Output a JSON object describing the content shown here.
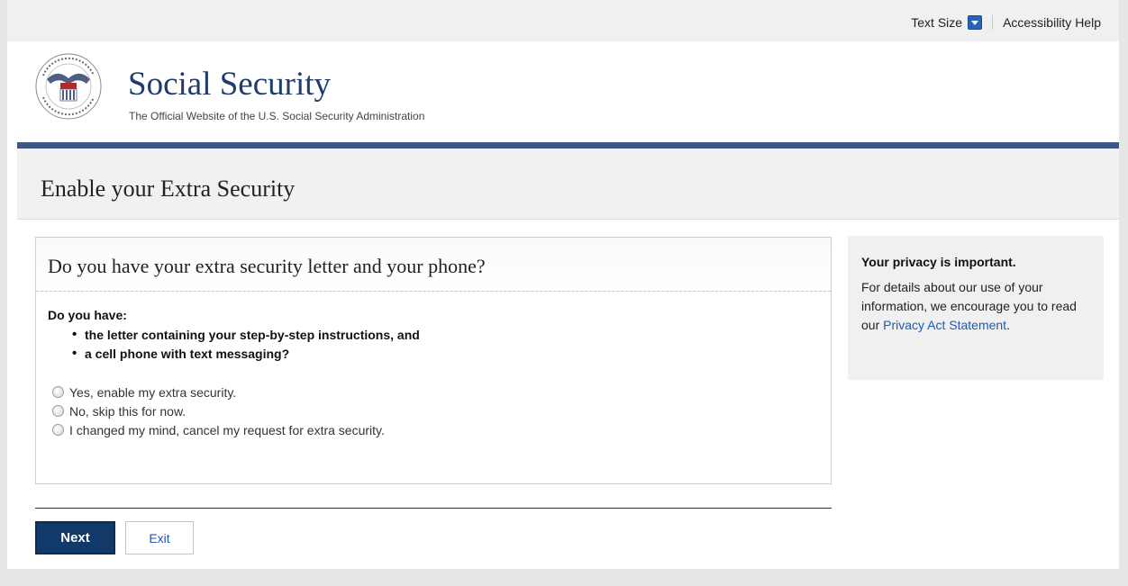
{
  "utility": {
    "text_size": "Text Size",
    "accessibility_help": "Accessibility Help"
  },
  "brand": {
    "seal_text": "SOCIAL SECURITY ADMINISTRATION USA",
    "title": "Social Security",
    "subtitle": "The Official Website of the U.S. Social Security Administration"
  },
  "page": {
    "title": "Enable your Extra Security"
  },
  "question": {
    "title": "Do you have your extra security letter and your phone?",
    "do_you_have": "Do you have:",
    "requirements": [
      "the letter containing your step-by-step instructions, and",
      "a cell phone with text messaging?"
    ],
    "options": [
      "Yes, enable my extra security.",
      "No, skip this for now.",
      "I changed my mind, cancel my request for extra security."
    ]
  },
  "actions": {
    "next": "Next",
    "exit": "Exit"
  },
  "privacy": {
    "title": "Your privacy is important.",
    "text": "For details about our use of your information, we encourage you to read our ",
    "link": "Privacy Act Statement",
    "end": "."
  },
  "colors": {
    "brand_navy": "#203c6d",
    "header_rule": "#3d5684",
    "button_next": "#113a6b",
    "link_blue": "#1a5bb5"
  }
}
